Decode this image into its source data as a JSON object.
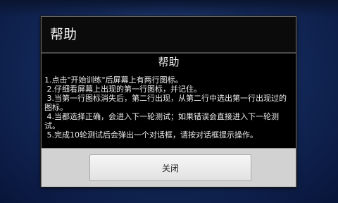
{
  "dialog": {
    "title": "帮助",
    "heading": "帮助",
    "text": "1.点击\"开始训练\"后屏幕上有两行图标。\n 2.仔细看屏幕上出现的第一行图标，并记住。\n 3.当第一行图标消失后，第二行出现，从第二行中选出第一行出现过的图标。\n 4.当都选择正确，会进入下一轮测试；如果错误会直接进入下一轮测试。\n 5.完成10轮测试后会弹出一个对话框，请按对话框提示操作。",
    "close_label": "关闭"
  }
}
